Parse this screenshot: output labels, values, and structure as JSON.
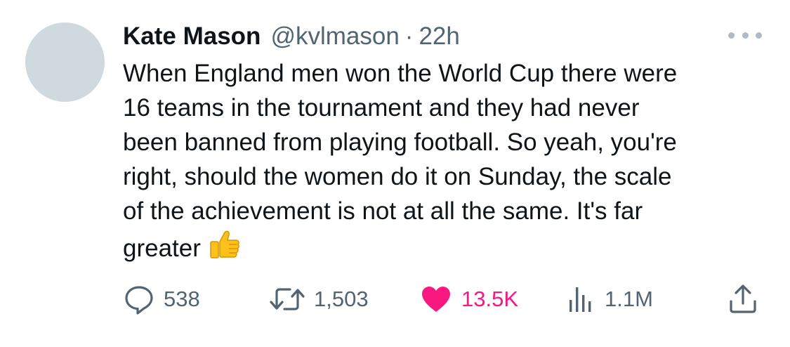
{
  "author": {
    "name": "Kate Mason",
    "handle": "@kvlmason",
    "separator": "·",
    "time": "22h"
  },
  "tweet": {
    "text": "When England men won the World Cup there were\n16 teams in the tournament and they had never\nbeen banned from playing football. So yeah, you're\nright, should the women do it on Sunday, the scale\nof the achievement is not at all the same. It's far\ngreater",
    "emoji": "thumbs-up-emoji"
  },
  "actions": {
    "replies": "538",
    "retweets": "1,503",
    "likes": "13.5K",
    "views": "1.1M"
  },
  "icons": {
    "reply": "reply-bubble-icon",
    "retweet": "retweet-icon",
    "like": "heart-icon",
    "views": "views-bars-icon",
    "share": "share-icon",
    "more": "more-dots-icon"
  },
  "colors": {
    "text": "#0f1419",
    "secondary": "#536471",
    "like": "#f91880",
    "avatar": "#cfd9de"
  }
}
